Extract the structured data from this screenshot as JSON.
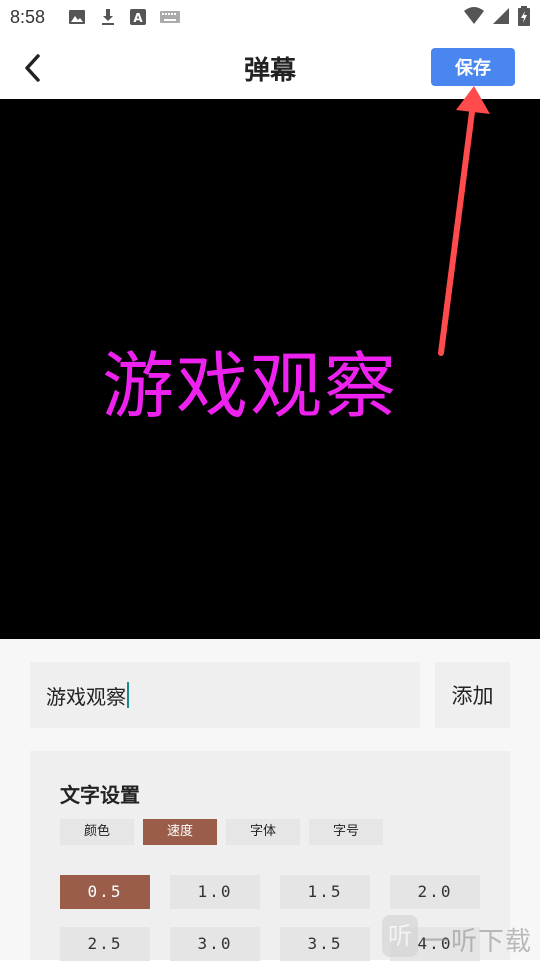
{
  "status_bar": {
    "time": "8:58",
    "left_icons": [
      "image-icon",
      "download-icon",
      "a-icon",
      "keyboard-icon"
    ],
    "right_icons": [
      "wifi-icon",
      "signal-icon",
      "battery-icon"
    ]
  },
  "header": {
    "title": "弹幕",
    "save_label": "保存",
    "accent_color": "#4a86f0"
  },
  "preview": {
    "text": "游戏观察",
    "text_color": "#ee22ee",
    "background": "#000000"
  },
  "input": {
    "value": "游戏观察",
    "add_label": "添加"
  },
  "settings": {
    "title": "文字设置",
    "tabs": [
      {
        "label": "颜色",
        "active": false
      },
      {
        "label": "速度",
        "active": true
      },
      {
        "label": "字体",
        "active": false
      },
      {
        "label": "字号",
        "active": false
      }
    ],
    "speed_options": [
      {
        "label": "0.5",
        "active": true
      },
      {
        "label": "1.0",
        "active": false
      },
      {
        "label": "1.5",
        "active": false
      },
      {
        "label": "2.0",
        "active": false
      },
      {
        "label": "2.5",
        "active": false
      },
      {
        "label": "3.0",
        "active": false
      },
      {
        "label": "3.5",
        "active": false
      },
      {
        "label": "4.0",
        "active": false
      }
    ],
    "active_color": "#9a5d4a"
  },
  "watermark": {
    "icon_char": "听",
    "text": "一听下载"
  }
}
